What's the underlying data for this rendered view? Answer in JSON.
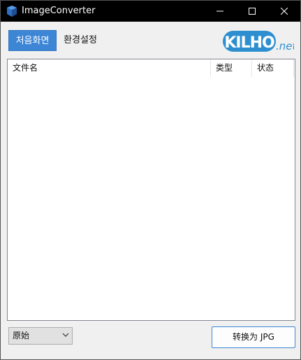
{
  "window": {
    "title": "ImageConverter",
    "icon": "app-icon",
    "controls": [
      "minimize-icon",
      "maximize-icon",
      "close-icon"
    ],
    "titlebar_color": "#000000"
  },
  "tabs": [
    {
      "label": "처음화면",
      "active": true
    },
    {
      "label": "환경설정",
      "active": false
    }
  ],
  "logo": {
    "brand": "KILHO",
    "suffix": ".net",
    "color": "#2e8fd0"
  },
  "list": {
    "columns": [
      "文件名",
      "类型",
      "状态"
    ],
    "rows": []
  },
  "footer": {
    "size_select": {
      "selected": "原始"
    },
    "convert_button": "转换为 JPG"
  },
  "colors": {
    "accent": "#3d86d6"
  }
}
